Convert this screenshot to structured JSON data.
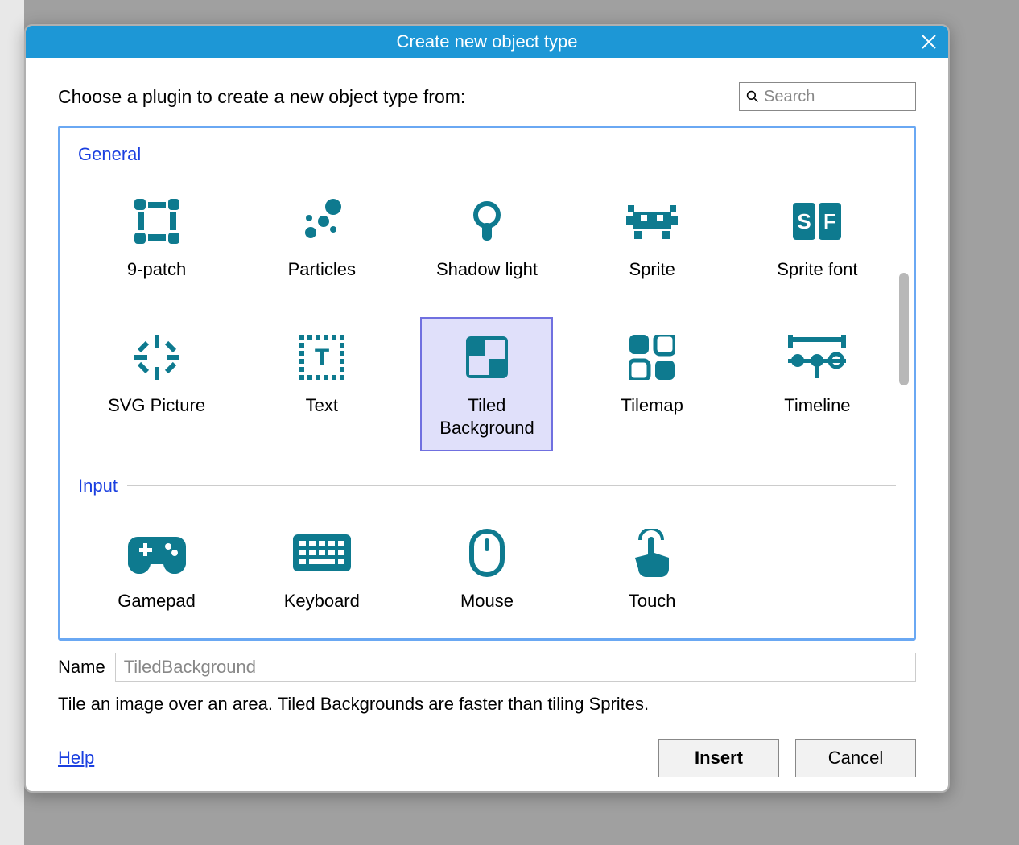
{
  "dialog": {
    "title": "Create new object type",
    "prompt": "Choose a plugin to create a new object type from:",
    "search_placeholder": "Search",
    "sections": {
      "general": "General",
      "input": "Input"
    },
    "plugins": {
      "nine_patch": "9-patch",
      "particles": "Particles",
      "shadow_light": "Shadow light",
      "sprite": "Sprite",
      "sprite_font": "Sprite font",
      "svg_picture": "SVG Picture",
      "text": "Text",
      "tiled_background": "Tiled Background",
      "tilemap": "Tilemap",
      "timeline": "Timeline",
      "gamepad": "Gamepad",
      "keyboard": "Keyboard",
      "mouse": "Mouse",
      "touch": "Touch"
    },
    "name_label": "Name",
    "name_value": "TiledBackground",
    "description": "Tile an image over an area. Tiled Backgrounds are faster than tiling Sprites.",
    "help": "Help",
    "insert": "Insert",
    "cancel": "Cancel"
  }
}
